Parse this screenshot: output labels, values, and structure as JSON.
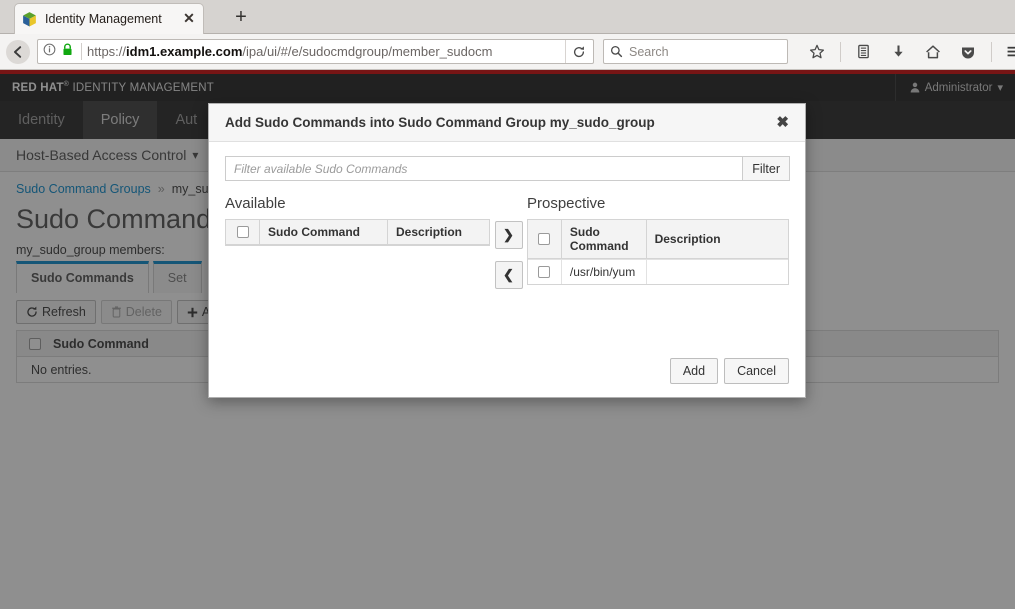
{
  "browser": {
    "tab": {
      "title": "Identity Management",
      "favicon": "freeipa-cube-icon",
      "close_label": "✕"
    },
    "new_tab_label": "+",
    "url": {
      "scheme": "https://",
      "host_pre": "idm1.",
      "host_bold": "example.com",
      "path": "/ipa/ui/#/e/sudocmdgroup/member_sudocm"
    },
    "search": {
      "placeholder": "Search"
    },
    "icons": [
      "back-icon",
      "info-icon",
      "lock-icon",
      "reload-icon",
      "search-icon",
      "bookmark-star-icon",
      "library-icon",
      "download-icon",
      "home-icon",
      "pocket-icon",
      "hamburger-menu-icon"
    ]
  },
  "app_header": {
    "brand_red_hat": "RED HAT",
    "brand_tm": "®",
    "brand_product": "IDENTITY MANAGEMENT",
    "user": "Administrator",
    "accent_red": "#cc0000",
    "header_bg": "#1a1a1a"
  },
  "nav": {
    "tabs": [
      {
        "label": "Identity",
        "active": false
      },
      {
        "label": "Policy",
        "active": true
      },
      {
        "label": "Aut",
        "active": false
      }
    ],
    "subnav": {
      "label": "Host-Based Access Control",
      "chevron": "⌄"
    }
  },
  "breadcrumb": {
    "parent": "Sudo Command Groups",
    "separator": "»",
    "current": "my_sud"
  },
  "page": {
    "title": "Sudo Command G",
    "members_label": "my_sudo_group members:",
    "facet_tabs": [
      {
        "label": "Sudo Commands",
        "active": true
      },
      {
        "label": "Set",
        "active": false
      }
    ],
    "toolbar": {
      "refresh": "Refresh",
      "delete": "Delete",
      "add": "Add",
      "refresh_icon": "refresh-icon",
      "delete_icon": "trash-icon",
      "add_icon": "plus-icon"
    },
    "table": {
      "columns": [
        "Sudo Command"
      ],
      "empty_message": "No entries."
    }
  },
  "modal": {
    "title": "Add Sudo Commands into Sudo Command Group my_sudo_group",
    "close_label": "✖",
    "filter": {
      "placeholder": "Filter available Sudo Commands",
      "value": "",
      "button_label": "Filter"
    },
    "available": {
      "heading": "Available",
      "columns": [
        "Sudo Command",
        "Description"
      ],
      "rows": []
    },
    "prospective": {
      "heading": "Prospective",
      "columns": [
        "Sudo Command",
        "Description"
      ],
      "rows": [
        {
          "command": "/usr/bin/yum",
          "description": ""
        }
      ]
    },
    "move_right_label": "❯",
    "move_left_label": "❮",
    "footer": {
      "add": "Add",
      "cancel": "Cancel"
    }
  }
}
